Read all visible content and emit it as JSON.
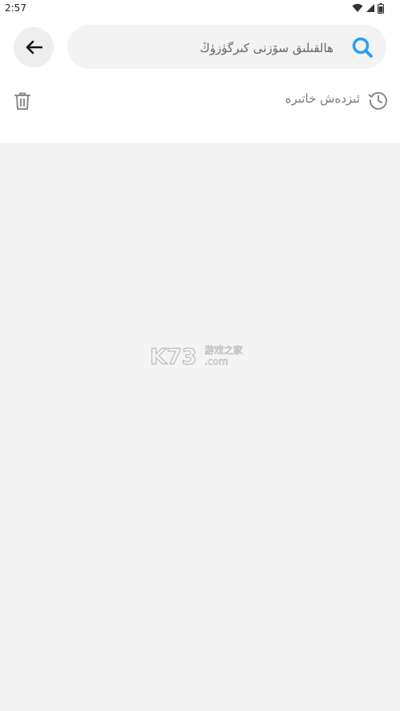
{
  "status_bar": {
    "time": "2:57",
    "icons": [
      "wifi-icon",
      "signal-icon",
      "battery-icon"
    ]
  },
  "header": {
    "back_icon": "arrow-left-icon",
    "search": {
      "placeholder": "ھالقىلىق سۆزنى كىرگۈزۈڭ",
      "value": "",
      "icon": "search-icon"
    }
  },
  "history": {
    "label": "ئىزدەش خاتىرە",
    "icon": "history-icon",
    "clear_icon": "trash-icon"
  },
  "watermark": {
    "brand": "K73",
    "cn_text": "游戏之家",
    "domain": ".com"
  },
  "colors": {
    "search_icon": "#2a9df4",
    "background": "#f4f4f4",
    "panel": "#ffffff",
    "muted_text": "#7a7a7a"
  }
}
